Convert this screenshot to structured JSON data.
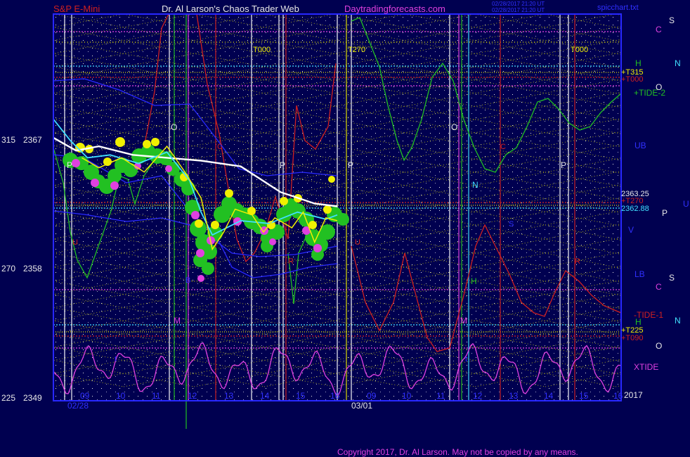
{
  "header": {
    "instrument": "S&P E-Mini",
    "author": "Dr. Al Larson's Chaos Trader Web",
    "site": "Daytradingforecasts.com",
    "stamp_line1": "02/28/2017 21:20 UT",
    "stamp_line2": "02/28/2017 21:20 UT",
    "filename": "spicchart.txt"
  },
  "footer": {
    "copyright": "Copyright 2017, Dr. Al Larson. May not be copied by any means."
  },
  "colors": {
    "background": "#000050",
    "frame": "#2828ff",
    "grid": "#e0e000",
    "price_white": "#ffffff",
    "cyan": "#40e0ff",
    "green": "#22c022",
    "red": "#d02020",
    "magenta": "#e040e0",
    "yellow": "#f0f000"
  },
  "chart_data": {
    "type": "line",
    "title": "S&P E-Mini",
    "y_axis": {
      "min": 2349,
      "max": 2367,
      "ticks": [
        {
          "angle": "315",
          "price": "2367"
        },
        {
          "angle": "270",
          "price": "2358"
        },
        {
          "angle": "225",
          "price": "2349"
        }
      ]
    },
    "x_axis": {
      "tick_labels": [
        "09",
        "10",
        "11",
        "12",
        "13",
        "14",
        "15",
        "16",
        "09",
        "10",
        "11",
        "12",
        "13",
        "14",
        "15",
        "16"
      ],
      "date_labels": [
        "02/28",
        "03/01"
      ],
      "year_label": "2017"
    },
    "vertical_markers": [
      "T000",
      "T270",
      "T000"
    ],
    "shape_letters": [
      "O",
      "P",
      "P",
      "O",
      "P",
      "P",
      "M",
      "M",
      "N",
      "H",
      "S",
      "C",
      "C",
      "B",
      "R",
      "R",
      "U",
      "U",
      "t",
      "t"
    ],
    "right_labels": [
      {
        "text": "C",
        "color": "magenta"
      },
      {
        "text": "S",
        "color": "white"
      },
      {
        "text": "N",
        "color": "cyan"
      },
      {
        "text": "H",
        "color": "green"
      },
      {
        "text": "+T315",
        "color": "yellow"
      },
      {
        "text": "+T000",
        "color": "red"
      },
      {
        "text": "O",
        "color": "white"
      },
      {
        "text": "+TIDE-2",
        "color": "green"
      },
      {
        "text": "UB",
        "color": "blue"
      },
      {
        "text": "2363.25",
        "color": "white"
      },
      {
        "text": "+T270",
        "color": "red"
      },
      {
        "text": "2362.88",
        "color": "cyan"
      },
      {
        "text": "U",
        "color": "blue"
      },
      {
        "text": "P",
        "color": "white"
      },
      {
        "text": "V",
        "color": "blue"
      },
      {
        "text": "LB",
        "color": "blue"
      },
      {
        "text": "C",
        "color": "magenta"
      },
      {
        "text": "S",
        "color": "white"
      },
      {
        "text": "-TIDE-1",
        "color": "red"
      },
      {
        "text": "H",
        "color": "green"
      },
      {
        "text": "N",
        "color": "cyan"
      },
      {
        "text": "+T225",
        "color": "yellow"
      },
      {
        "text": "+T090",
        "color": "red"
      },
      {
        "text": "O",
        "color": "white"
      },
      {
        "text": "XTIDE",
        "color": "magenta"
      }
    ],
    "series": [
      {
        "name": "",
        "color": "white",
        "x": [
          0,
          0.04,
          0.08,
          0.14,
          0.2,
          0.26,
          0.33,
          0.4,
          0.46,
          0.5
        ],
        "y": [
          2367.2,
          2366.3,
          2366.6,
          2366.0,
          2365.8,
          2365.6,
          2365.2,
          2363.4,
          2362.6,
          2362.4
        ]
      },
      {
        "name": "",
        "color": "cyan",
        "x": [
          0,
          0.03,
          0.06,
          0.1,
          0.15,
          0.2,
          0.24,
          0.26,
          0.28,
          0.33,
          0.38,
          0.43,
          0.48,
          0.5
        ],
        "y": [
          2368.5,
          2367.0,
          2365.8,
          2366.0,
          2365.4,
          2366.2,
          2364.2,
          2362.0,
          2360.4,
          2361.4,
          2361.2,
          2362.0,
          2361.5,
          2361.8
        ]
      },
      {
        "name": "",
        "color": "yellow",
        "x": [
          0.05,
          0.08,
          0.12,
          0.16,
          0.2,
          0.23,
          0.26,
          0.28,
          0.3,
          0.32,
          0.35,
          0.37,
          0.39,
          0.42,
          0.44,
          0.46,
          0.48,
          0.5
        ],
        "y": [
          2365.8,
          2365.1,
          2365.8,
          2364.8,
          2366.6,
          2364.9,
          2363.0,
          2359.4,
          2360.6,
          2362.2,
          2361.8,
          2360.6,
          2361.6,
          2360.9,
          2362.0,
          2359.9,
          2361.6,
          2361.4
        ]
      }
    ]
  }
}
